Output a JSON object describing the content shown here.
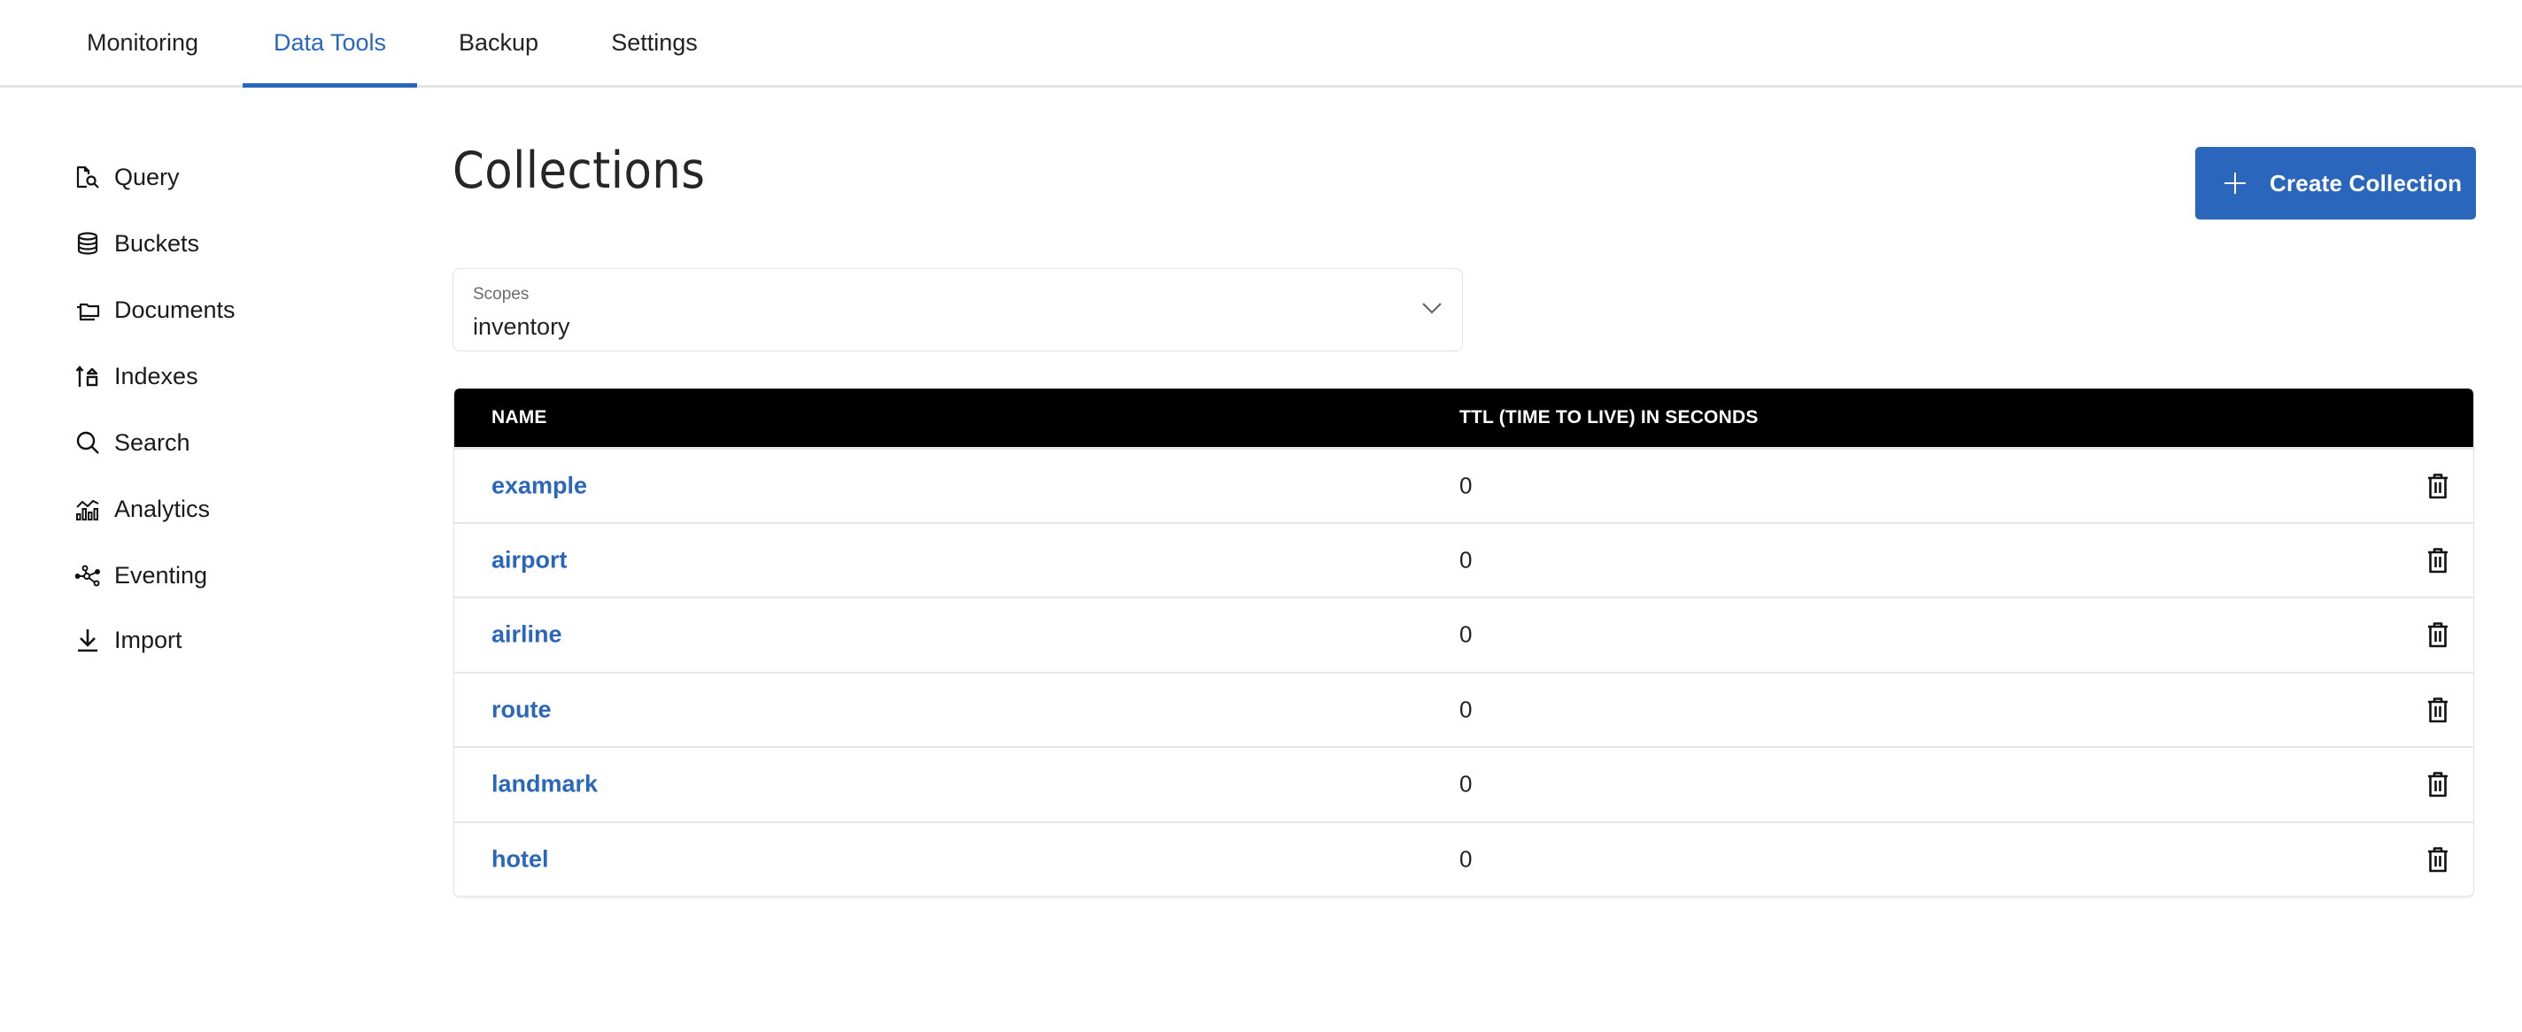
{
  "colors": {
    "accent": "#2a66bc",
    "table_header_bg": "#000000",
    "text": "#222222",
    "muted": "#6b6b6b",
    "border": "#e3e3e3"
  },
  "topnav": {
    "tabs": [
      {
        "label": "Monitoring",
        "active": false
      },
      {
        "label": "Data Tools",
        "active": true
      },
      {
        "label": "Backup",
        "active": false
      },
      {
        "label": "Settings",
        "active": false
      }
    ]
  },
  "sidebar": {
    "items": [
      {
        "label": "Query",
        "icon": "query-document-search-icon"
      },
      {
        "label": "Buckets",
        "icon": "database-icon"
      },
      {
        "label": "Documents",
        "icon": "folders-icon"
      },
      {
        "label": "Indexes",
        "icon": "index-sort-icon"
      },
      {
        "label": "Search",
        "icon": "search-icon"
      },
      {
        "label": "Analytics",
        "icon": "analytics-chart-icon"
      },
      {
        "label": "Eventing",
        "icon": "eventing-nodes-icon"
      },
      {
        "label": "Import",
        "icon": "download-icon"
      }
    ]
  },
  "main": {
    "title": "Collections",
    "create_button": {
      "label": "Create Collection",
      "icon": "plus-icon"
    },
    "scope_select": {
      "label": "Scopes",
      "value": "inventory",
      "icon": "chevron-down-icon"
    },
    "table": {
      "columns": [
        "NAME",
        "TTL (TIME TO LIVE) IN SECONDS"
      ],
      "rows": [
        {
          "name": "example",
          "ttl": "0"
        },
        {
          "name": "airport",
          "ttl": "0"
        },
        {
          "name": "airline",
          "ttl": "0"
        },
        {
          "name": "route",
          "ttl": "0"
        },
        {
          "name": "landmark",
          "ttl": "0"
        },
        {
          "name": "hotel",
          "ttl": "0"
        }
      ],
      "row_action_icon": "trash-icon"
    }
  }
}
